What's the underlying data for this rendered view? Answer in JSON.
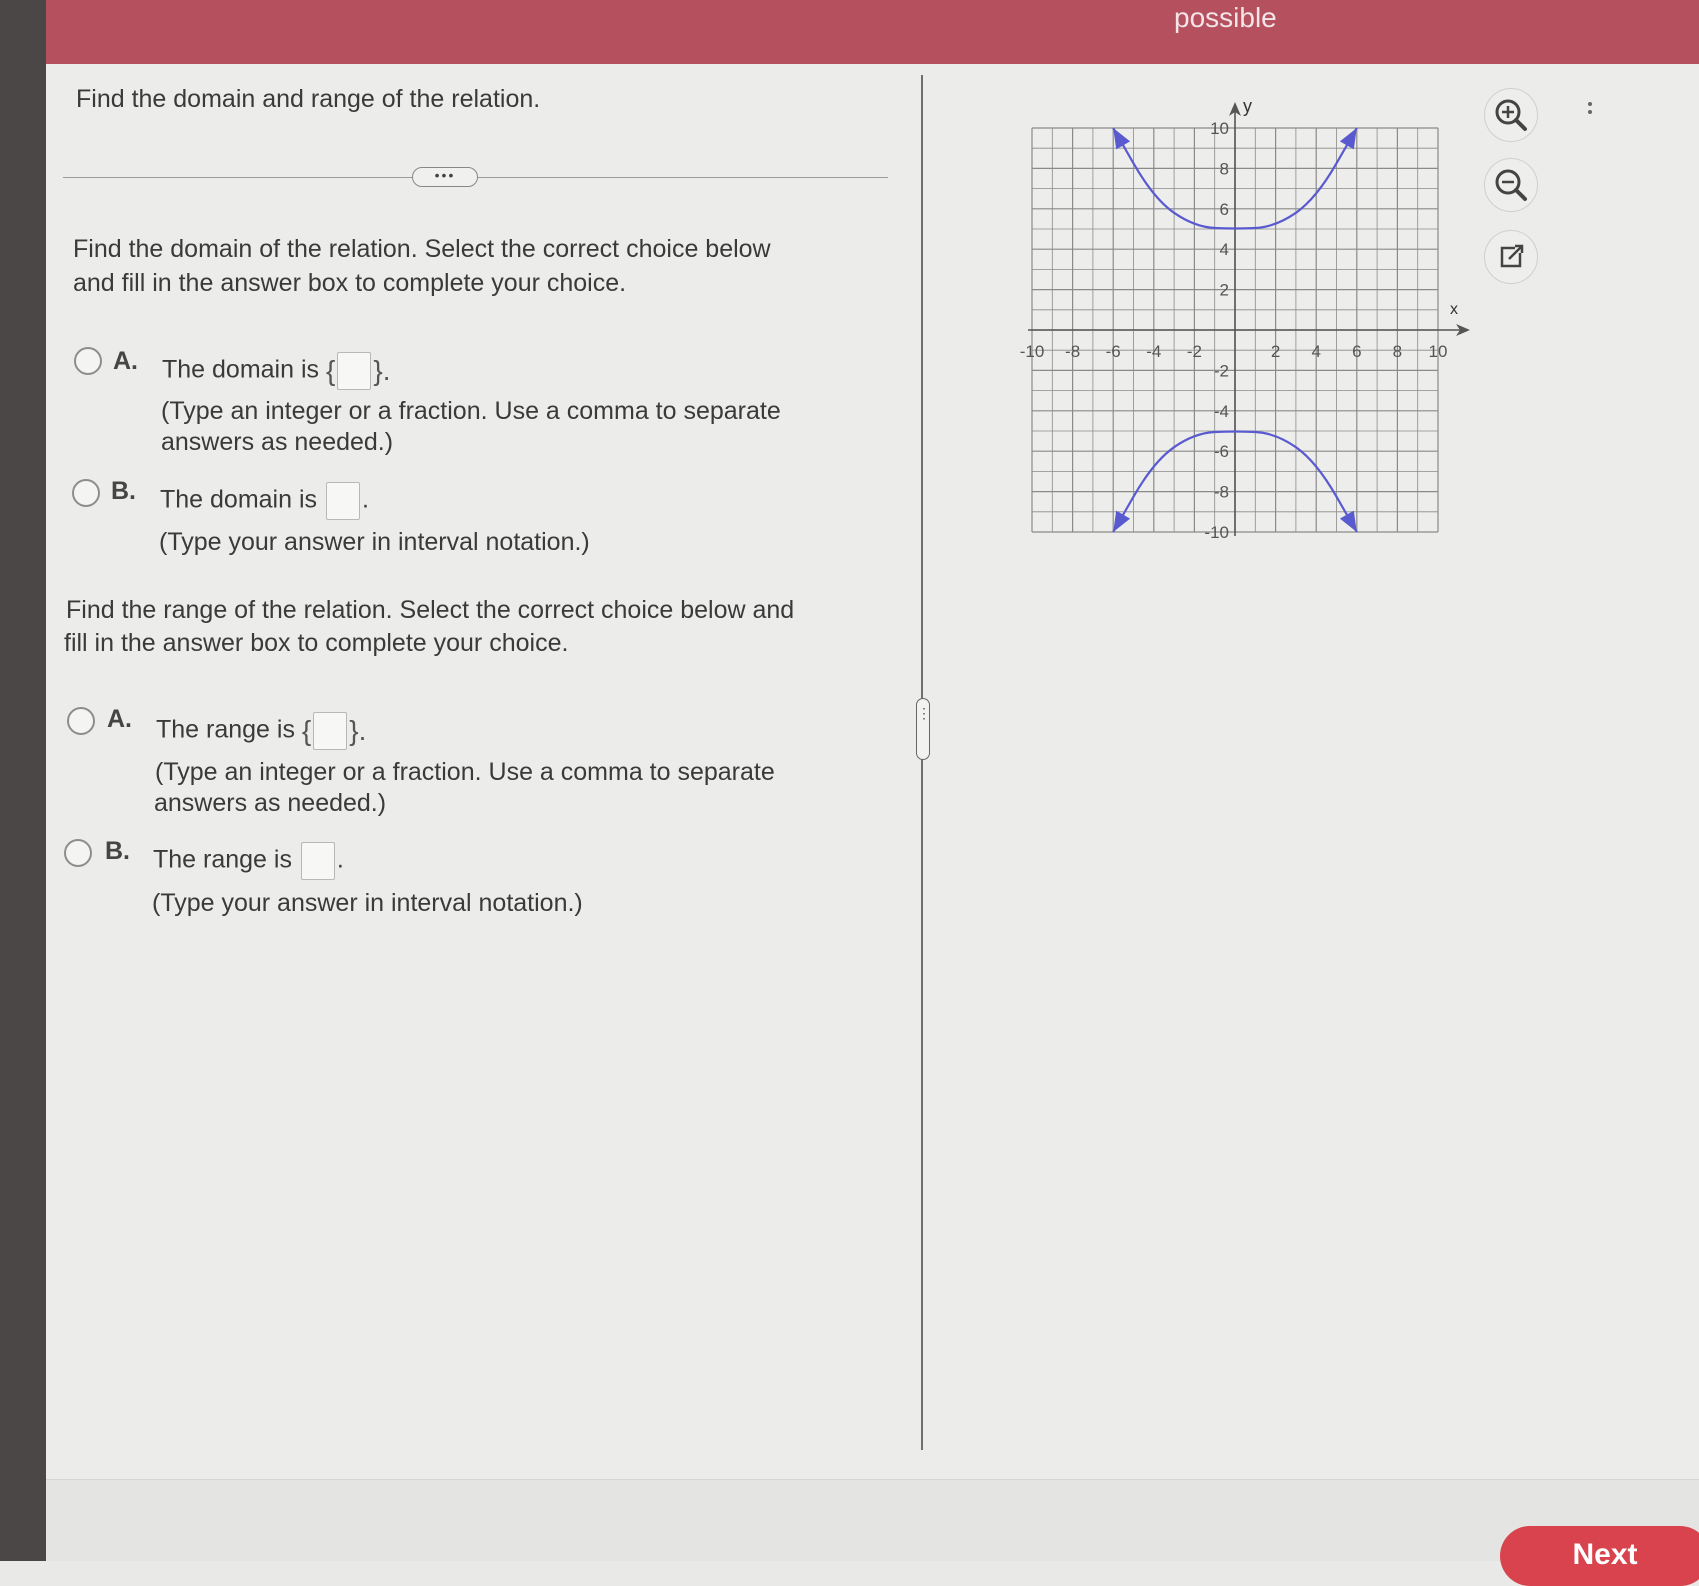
{
  "header": {
    "possible_text": "possible"
  },
  "question": {
    "prompt": "Find the domain and range of the relation.",
    "expand_label": "•••"
  },
  "domain_section": {
    "instruction_line1": "Find the domain of the relation. Select the correct choice below",
    "instruction_line2": "and fill in the answer box to complete your choice.",
    "option_a": {
      "letter": "A.",
      "text": "The domain is",
      "open_brace": "{",
      "close_brace": "}.",
      "hint_line1": "(Type an integer or a fraction. Use a comma to separate",
      "hint_line2": "answers as needed.)"
    },
    "option_b": {
      "letter": "B.",
      "text": "The domain is",
      "period": ".",
      "hint": "(Type your answer in interval notation.)"
    }
  },
  "range_section": {
    "instruction_line1": "Find the range of the relation. Select the correct choice below and",
    "instruction_line2": "fill in the answer box to complete your choice.",
    "option_a": {
      "letter": "A.",
      "text": "The range is",
      "open_brace": "{",
      "close_brace": "}.",
      "hint_line1": "(Type an integer or a fraction. Use a comma to separate",
      "hint_line2": "answers as needed.)"
    },
    "option_b": {
      "letter": "B.",
      "text": "The range is",
      "period": ".",
      "hint": "(Type your answer in interval notation.)"
    }
  },
  "graph": {
    "x_axis_label": "x",
    "y_axis_label": "y",
    "x_range": [
      -10,
      10
    ],
    "y_range": [
      -10,
      10
    ],
    "x_tick_labels": [
      "-10",
      "-8",
      "-6",
      "-4",
      "-2",
      "2",
      "4",
      "6",
      "8",
      "10"
    ],
    "y_tick_labels": [
      "10",
      "8",
      "6",
      "4",
      "2",
      "-2",
      "-4",
      "-6",
      "-8",
      "-10"
    ],
    "curve_color": "#5a5ad0",
    "curves": [
      {
        "name": "upper",
        "points": [
          [
            -6,
            10
          ],
          [
            -4,
            6.5
          ],
          [
            -2,
            5.1
          ],
          [
            0,
            5
          ],
          [
            2,
            5.1
          ],
          [
            4,
            6.5
          ],
          [
            6,
            10
          ]
        ]
      },
      {
        "name": "lower",
        "points": [
          [
            -6,
            -10
          ],
          [
            -4,
            -6.5
          ],
          [
            -2,
            -5.1
          ],
          [
            0,
            -5
          ],
          [
            2,
            -5.1
          ],
          [
            4,
            -6.5
          ],
          [
            6,
            -10
          ]
        ]
      }
    ]
  },
  "tools": {
    "zoom_in_icon": "zoom-in-icon",
    "zoom_out_icon": "zoom-out-icon",
    "external_icon": "external-link-icon"
  },
  "footer": {
    "next_label": "Next"
  }
}
